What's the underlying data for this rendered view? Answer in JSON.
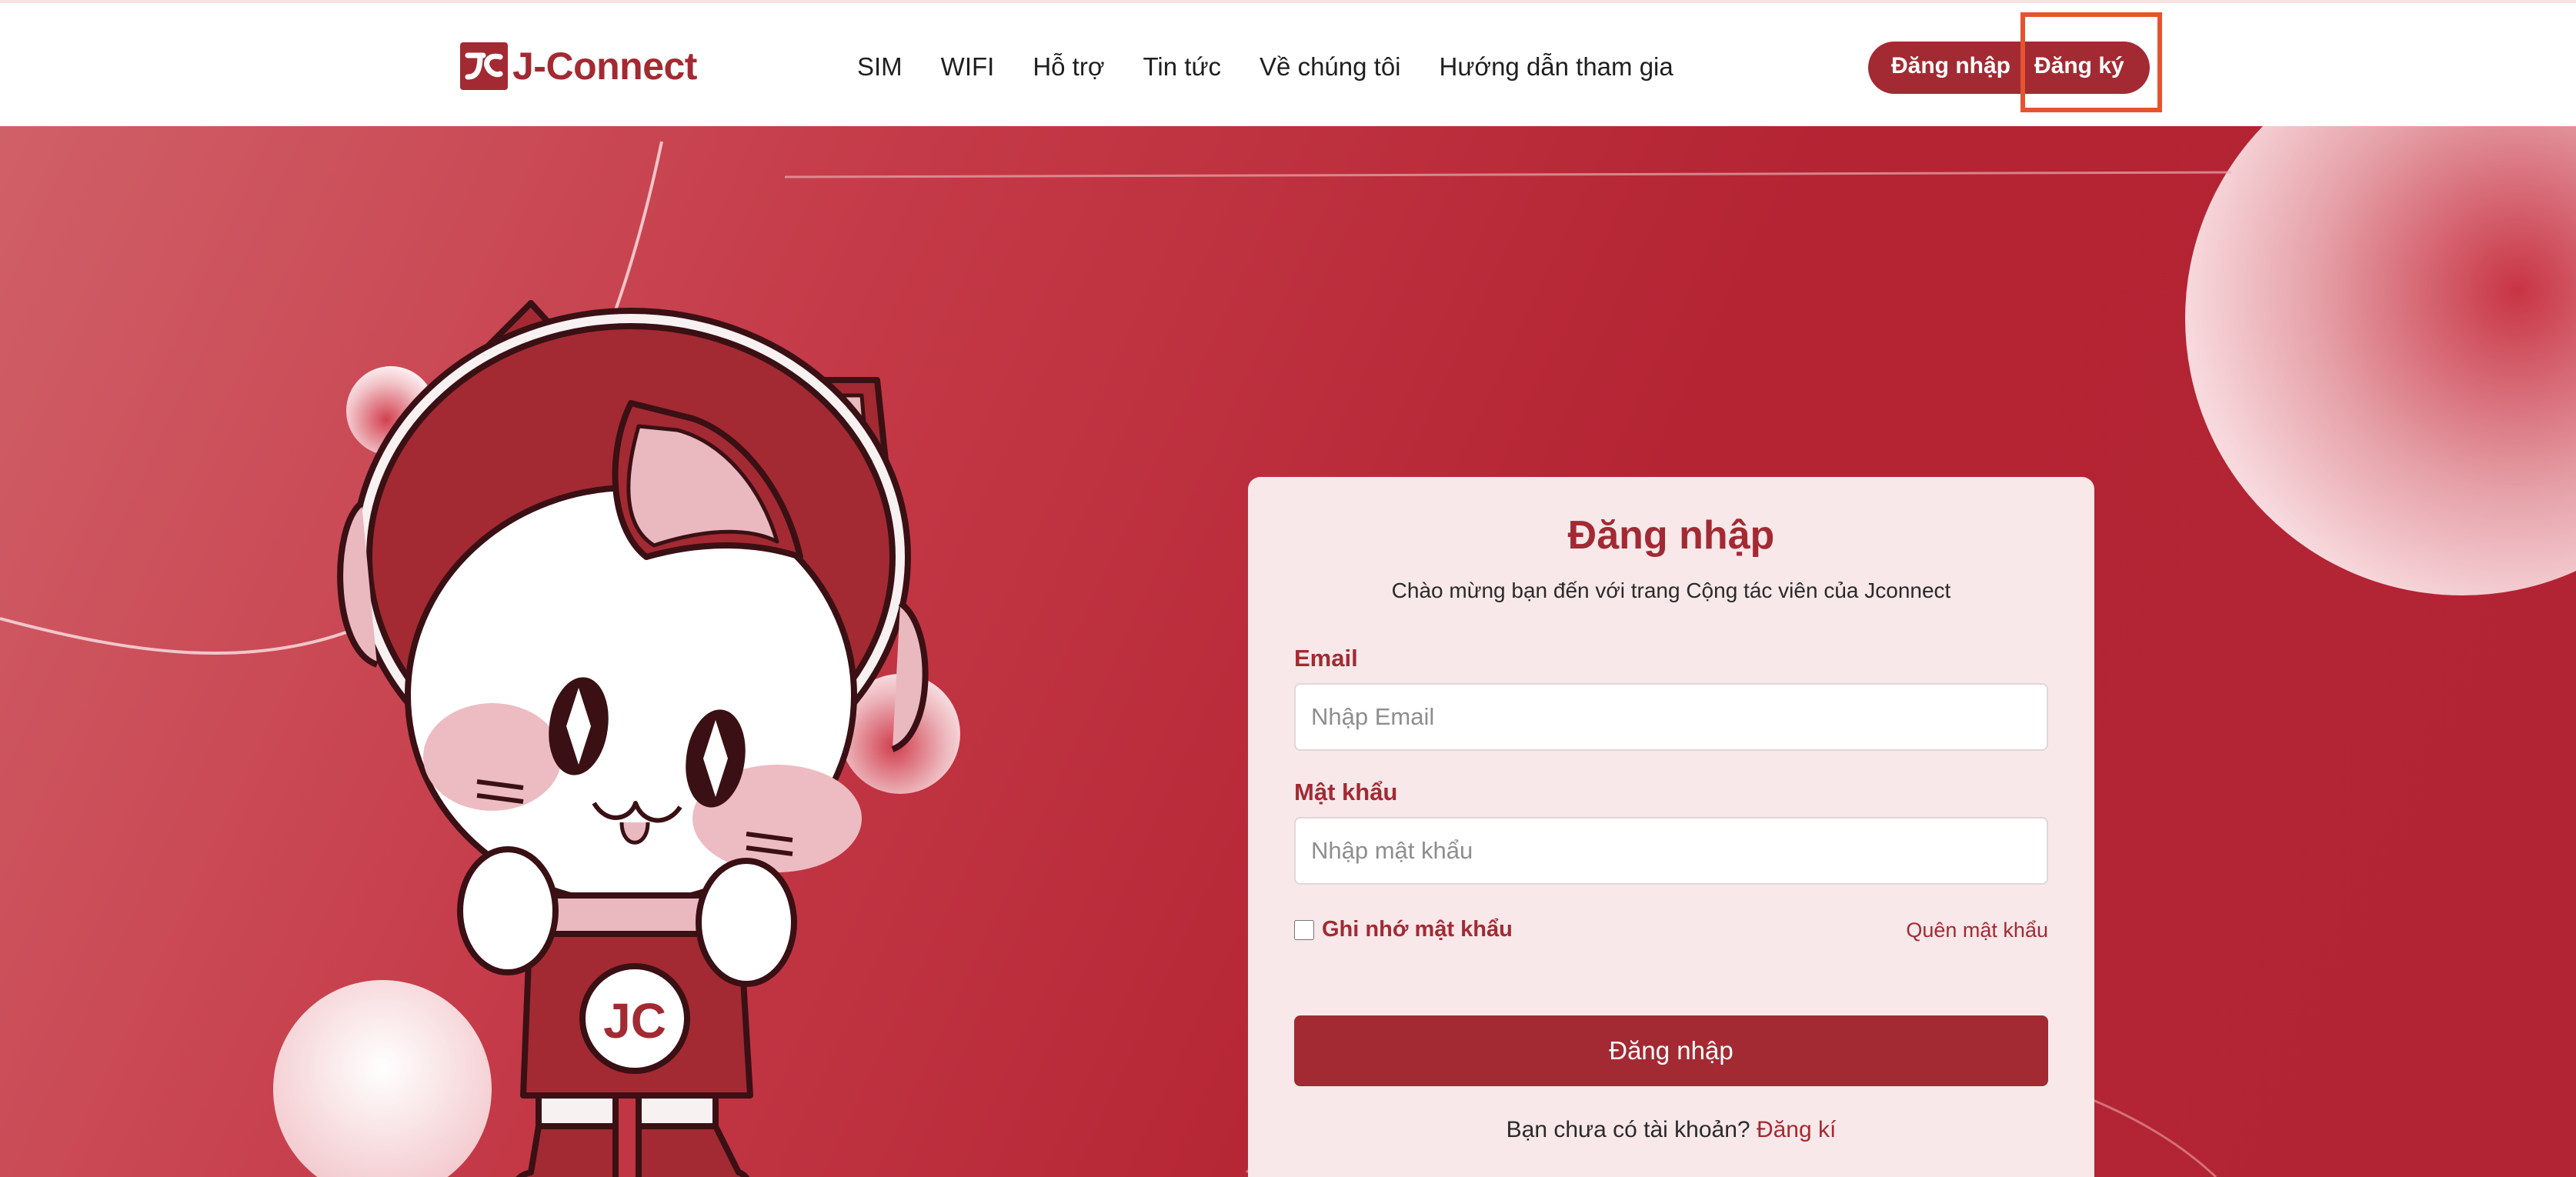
{
  "header": {
    "logo_text": "J-Connect",
    "logo_mark": "JC",
    "nav": [
      {
        "label": "SIM"
      },
      {
        "label": "WIFI"
      },
      {
        "label": "Hỗ trợ"
      },
      {
        "label": "Tin tức"
      },
      {
        "label": "Về chúng tôi"
      },
      {
        "label": "Hướng dẫn tham gia"
      }
    ],
    "login_label": "Đăng nhập",
    "register_label": "Đăng ký"
  },
  "login_card": {
    "title": "Đăng nhập",
    "subtitle": "Chào mừng bạn đến với trang Cộng tác viên của Jconnect",
    "email_label": "Email",
    "email_placeholder": "Nhập Email",
    "email_value": "",
    "password_label": "Mật khẩu",
    "password_placeholder": "Nhập mật khẩu",
    "password_value": "",
    "remember_label": "Ghi nhớ mật khẩu",
    "remember_checked": false,
    "forgot_label": "Quên mật khẩu",
    "submit_label": "Đăng nhập",
    "signup_prompt": "Bạn chưa có tài khoản?",
    "signup_link": "Đăng kí"
  },
  "colors": {
    "brand": "#a32a32",
    "hero_bg": "#b42433",
    "card_bg": "#f8e8ea",
    "highlight": "#e5532f"
  },
  "icons": {
    "logo": "jc-logo-icon",
    "mascot": "cat-astronaut-mascot"
  }
}
